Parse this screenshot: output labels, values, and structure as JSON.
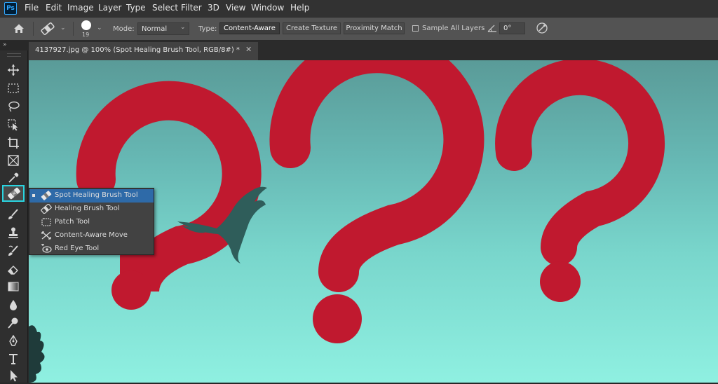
{
  "app": {
    "logo_text": "Ps"
  },
  "menu": [
    "File",
    "Edit",
    "Image",
    "Layer",
    "Type",
    "Select",
    "Filter",
    "3D",
    "View",
    "Window",
    "Help"
  ],
  "options": {
    "brush_size": "19",
    "mode_label": "Mode:",
    "mode_value": "Normal",
    "type_label": "Type:",
    "type_options": [
      "Content-Aware",
      "Create Texture",
      "Proximity Match"
    ],
    "type_selected": "Content-Aware",
    "sample_all_layers": "Sample All Layers",
    "sample_all_layers_checked": false,
    "angle_value": "0°"
  },
  "document": {
    "tab_title": "4137927.jpg @ 100% (Spot Healing Brush Tool, RGB/8#) *"
  },
  "tool_flyout": {
    "items": [
      {
        "label": "Spot Healing Brush Tool",
        "icon": "spot-healing-icon",
        "selected": true
      },
      {
        "label": "Healing Brush Tool",
        "icon": "healing-brush-icon",
        "selected": false
      },
      {
        "label": "Patch Tool",
        "icon": "patch-icon",
        "selected": false
      },
      {
        "label": "Content-Aware Move",
        "icon": "content-aware-move-icon",
        "selected": false
      },
      {
        "label": "Red Eye Tool",
        "icon": "red-eye-icon",
        "selected": false
      }
    ]
  },
  "colors": {
    "question_mark": "#c0192f",
    "active_tool_highlight": "#2ad4e0",
    "canvas_top": "#5a9b98",
    "canvas_bottom": "#8ff0e1"
  }
}
